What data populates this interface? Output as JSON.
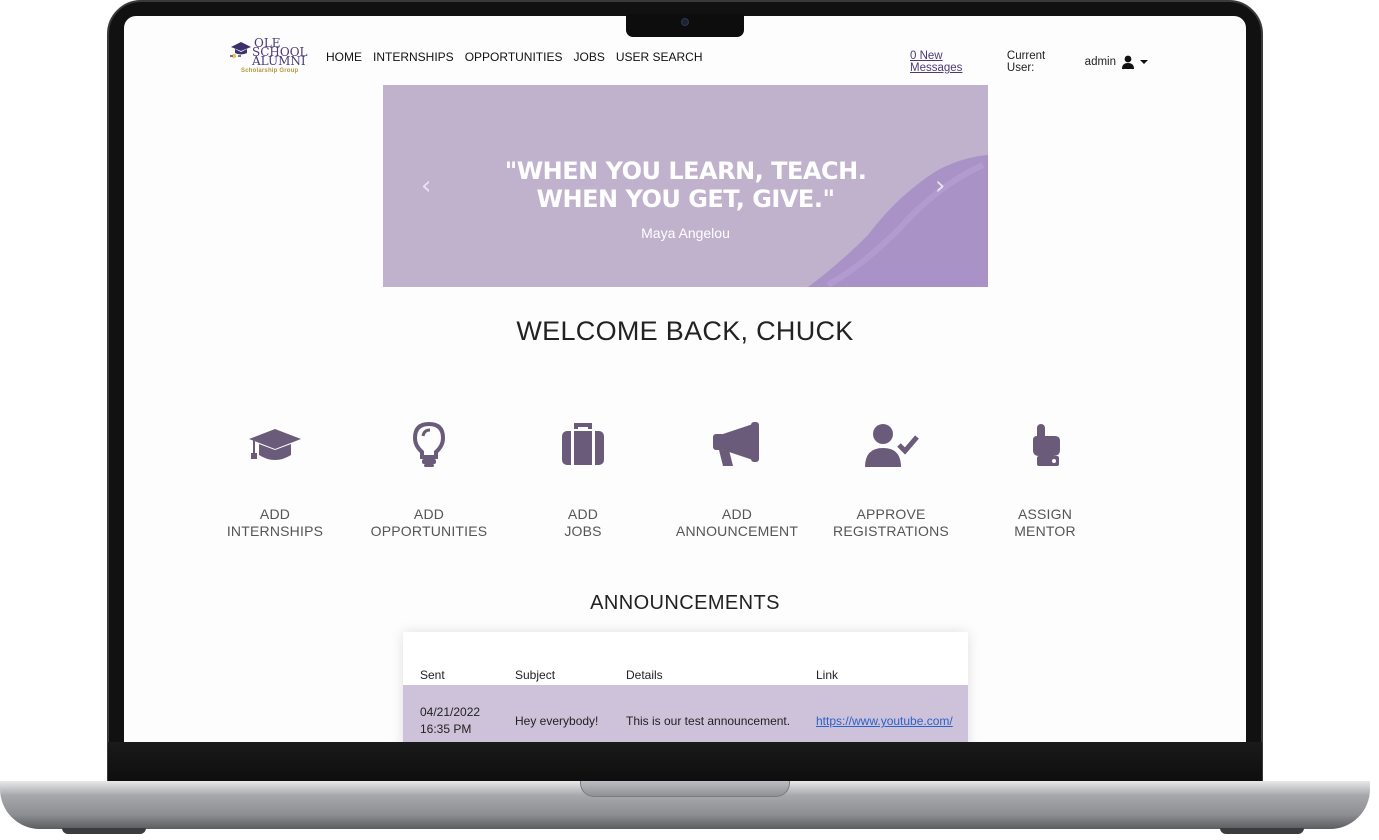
{
  "nav": {
    "logo": {
      "line1": "OLE",
      "line2": "SCHOOL",
      "line3": "ALUMNI",
      "tagline": "Scholarship Group"
    },
    "menu": [
      "HOME",
      "INTERNSHIPS",
      "OPPORTUNITIES",
      "JOBS",
      "USER SEARCH"
    ],
    "messages": "0 New Messages",
    "current_user_label": "Current User:",
    "current_user": "admin"
  },
  "banner": {
    "quote_line1": "\"WHEN YOU LEARN, TEACH.",
    "quote_line2": "WHEN YOU GET, GIVE.\"",
    "author": "Maya Angelou",
    "prev": "‹",
    "next": "›"
  },
  "welcome": "WELCOME BACK, CHUCK",
  "actions": [
    {
      "line1": "ADD",
      "line2": "INTERNSHIPS",
      "icon": "graduation-cap-icon"
    },
    {
      "line1": "ADD",
      "line2": "OPPORTUNITIES",
      "icon": "lightbulb-icon"
    },
    {
      "line1": "ADD",
      "line2": "JOBS",
      "icon": "briefcase-icon"
    },
    {
      "line1": "ADD",
      "line2": "ANNOUNCEMENT",
      "icon": "megaphone-icon"
    },
    {
      "line1": "APPROVE",
      "line2": "REGISTRATIONS",
      "icon": "user-check-icon"
    },
    {
      "line1": "ASSIGN",
      "line2": "MENTOR",
      "icon": "hand-pointer-icon"
    }
  ],
  "announcements": {
    "title": "ANNOUNCEMENTS",
    "columns": [
      "Sent",
      "Subject",
      "Details",
      "Link"
    ],
    "rows": [
      {
        "sent_date": "04/21/2022",
        "sent_time": "16:35 PM",
        "subject": "Hey everybody!",
        "details": "This is our test announcement.",
        "link": "https://www.youtube.com/"
      }
    ]
  },
  "colors": {
    "accent": "#6b5b7b",
    "banner": "#c0b2cd",
    "row": "#cdc2d9"
  }
}
